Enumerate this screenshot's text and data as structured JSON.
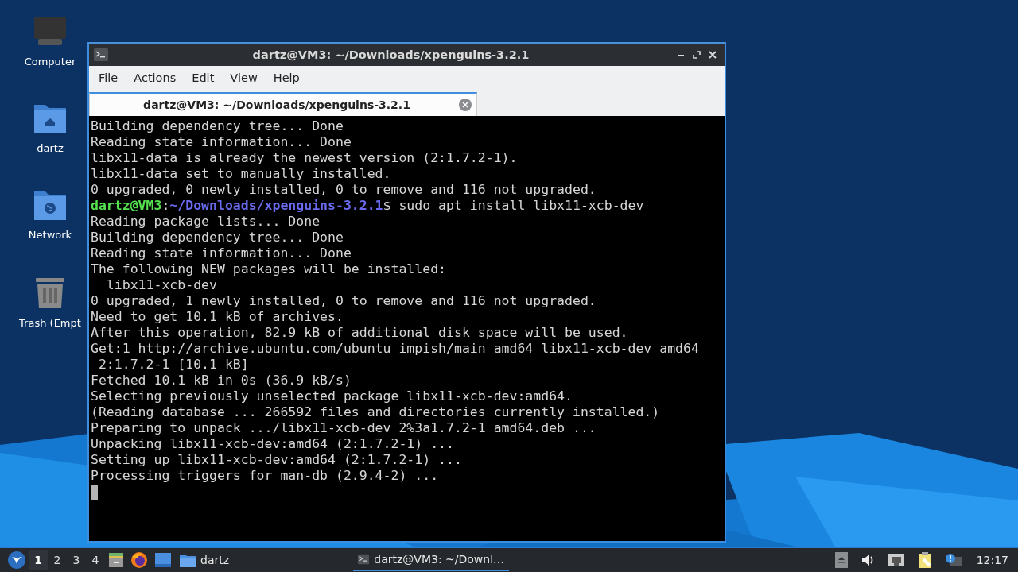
{
  "desktop_icons": [
    {
      "label": "Computer",
      "kind": "computer"
    },
    {
      "label": "dartz",
      "kind": "home"
    },
    {
      "label": "Network",
      "kind": "network"
    },
    {
      "label": "Trash (Empt",
      "kind": "trash"
    }
  ],
  "window": {
    "title": "dartz@VM3: ~/Downloads/xpenguins-3.2.1",
    "menu": [
      "File",
      "Actions",
      "Edit",
      "View",
      "Help"
    ],
    "tabs": [
      {
        "label": "dartz@VM3: ~/Downloads/xpenguins-3.2.1",
        "selected": true
      }
    ],
    "terminal": {
      "lines": [
        {
          "kind": "output",
          "text": "Building dependency tree... Done"
        },
        {
          "kind": "output",
          "text": "Reading state information... Done"
        },
        {
          "kind": "output",
          "text": "libx11-data is already the newest version (2:1.7.2-1)."
        },
        {
          "kind": "output",
          "text": "libx11-data set to manually installed."
        },
        {
          "kind": "output",
          "text": "0 upgraded, 0 newly installed, 0 to remove and 116 not upgraded."
        },
        {
          "kind": "prompt",
          "user": "dartz@VM3",
          "separator": ":",
          "path": "~/Downloads/xpenguins-3.2.1",
          "command": "$ sudo apt install libx11-xcb-dev"
        },
        {
          "kind": "output",
          "text": "Reading package lists... Done"
        },
        {
          "kind": "output",
          "text": "Building dependency tree... Done"
        },
        {
          "kind": "output",
          "text": "Reading state information... Done"
        },
        {
          "kind": "output",
          "text": "The following NEW packages will be installed:"
        },
        {
          "kind": "output",
          "text": "  libx11-xcb-dev"
        },
        {
          "kind": "output",
          "text": "0 upgraded, 1 newly installed, 0 to remove and 116 not upgraded."
        },
        {
          "kind": "output",
          "text": "Need to get 10.1 kB of archives."
        },
        {
          "kind": "output",
          "text": "After this operation, 82.9 kB of additional disk space will be used."
        },
        {
          "kind": "output",
          "text": "Get:1 http://archive.ubuntu.com/ubuntu impish/main amd64 libx11-xcb-dev amd64"
        },
        {
          "kind": "output",
          "text": " 2:1.7.2-1 [10.1 kB]"
        },
        {
          "kind": "output",
          "text": "Fetched 10.1 kB in 0s (36.9 kB/s)"
        },
        {
          "kind": "output",
          "text": "Selecting previously unselected package libx11-xcb-dev:amd64."
        },
        {
          "kind": "output",
          "text": "(Reading database ... 266592 files and directories currently installed.)"
        },
        {
          "kind": "output",
          "text": "Preparing to unpack .../libx11-xcb-dev_2%3a1.7.2-1_amd64.deb ..."
        },
        {
          "kind": "output",
          "text": "Unpacking libx11-xcb-dev:amd64 (2:1.7.2-1) ..."
        },
        {
          "kind": "output",
          "text": "Setting up libx11-xcb-dev:amd64 (2:1.7.2-1) ..."
        },
        {
          "kind": "output",
          "text": "Processing triggers for man-db (2.9.4-2) ..."
        },
        {
          "kind": "cursor"
        }
      ]
    }
  },
  "taskbar": {
    "workspaces": [
      {
        "label": "1",
        "selected": true
      },
      {
        "label": "2",
        "selected": false
      },
      {
        "label": "3",
        "selected": false
      },
      {
        "label": "4",
        "selected": false
      }
    ],
    "tasks": [
      {
        "label": "dartz",
        "kind": "folder",
        "selected": false
      },
      {
        "label": "dartz@VM3: ~/Downl…",
        "kind": "terminal",
        "selected": true
      }
    ],
    "clock": "12:17"
  }
}
